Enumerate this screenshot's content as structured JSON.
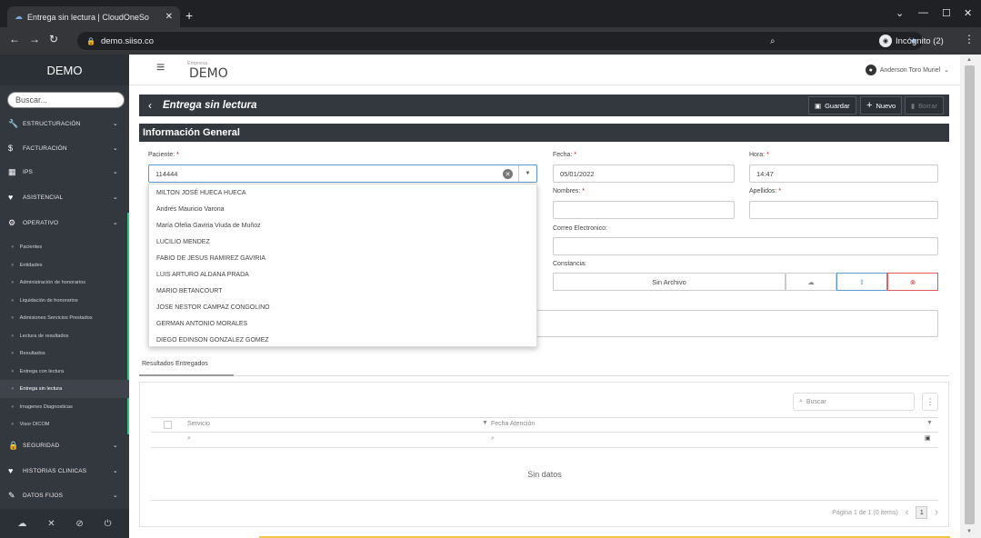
{
  "browser": {
    "tab_title": "Entrega sin lectura | CloudOneSo",
    "url": "demo.siiso.co",
    "incognito_label": "Incógnito (2)"
  },
  "sidebar": {
    "brand": "DEMO",
    "search_placeholder": "Buscar...",
    "items": [
      {
        "label": "ESTRUCTURACIÓN",
        "icon": "wrench-icon"
      },
      {
        "label": "FACTURACIÓN",
        "icon": "dollar-icon"
      },
      {
        "label": "IPS",
        "icon": "building-icon"
      },
      {
        "label": "ASISTENCIAL",
        "icon": "heart-icon"
      },
      {
        "label": "OPERATIVO",
        "icon": "gears-icon"
      }
    ],
    "operativo_sub": [
      "Pacientes",
      "Entidades",
      "Administración de honorarios",
      "Liquidación de honorarios",
      "Admisiones Servicios Prestados",
      "Lectura de resultados",
      "Resultados",
      "Entrega con lectura",
      "Entrega sin lectura",
      "Imagenes Diagnosticas",
      "Visor DICOM"
    ],
    "items_bottom": [
      {
        "label": "SEGURIDAD",
        "icon": "lock-icon"
      },
      {
        "label": "HISTORIAS CLINICAS",
        "icon": "heart-icon"
      },
      {
        "label": "DATOS FIJOS",
        "icon": "tag-icon"
      }
    ]
  },
  "topbar": {
    "empresa_caption": "Empresa",
    "empresa_name": "DEMO",
    "user_name": "Anderson Toro Muriel"
  },
  "page": {
    "title": "Entrega sin lectura",
    "buttons": {
      "save": "Guardar",
      "new": "Nuevo",
      "delete": "Borrar"
    },
    "section_title": "Información General"
  },
  "form": {
    "paciente_label": "Paciente:",
    "paciente_value": "114444",
    "fecha_label": "Fecha:",
    "fecha_value": "05/01/2022",
    "hora_label": "Hora:",
    "hora_value": "14:47",
    "nombres_label": "Nombres:",
    "apellidos_label": "Apellidos:",
    "correo_label": "Correo Electronico:",
    "constancia_label": "Constancia:",
    "constancia_file": "Sin Archivo",
    "required_mark": "*"
  },
  "dropdown": [
    "MILTON JOSÉ HUECA HUECA",
    "Andrés Mauricio Varona",
    "María Ofelia Gaviria Viuda de Muñoz",
    "LUCILIO MENDEZ",
    "FABIO DE JESUS RAMIREZ GAVIRIA",
    "LUIS ARTURO ALDANA PRADA",
    "MARIO BETANCOURT",
    "JOSE NESTOR CAMPAZ CONGOLINO",
    "GERMAN ANTONIO MORALES",
    "DIEGO EDINSON GONZALEZ GOMEZ"
  ],
  "results": {
    "tab_label": "Resultados Entregados",
    "search_placeholder": "Buscar",
    "col_servicio": "Servicio",
    "col_fecha": "Fecha Atención",
    "empty_text": "Sin datos",
    "pager_text": "Página 1 de 1 (0 items)",
    "page_number": "1"
  }
}
